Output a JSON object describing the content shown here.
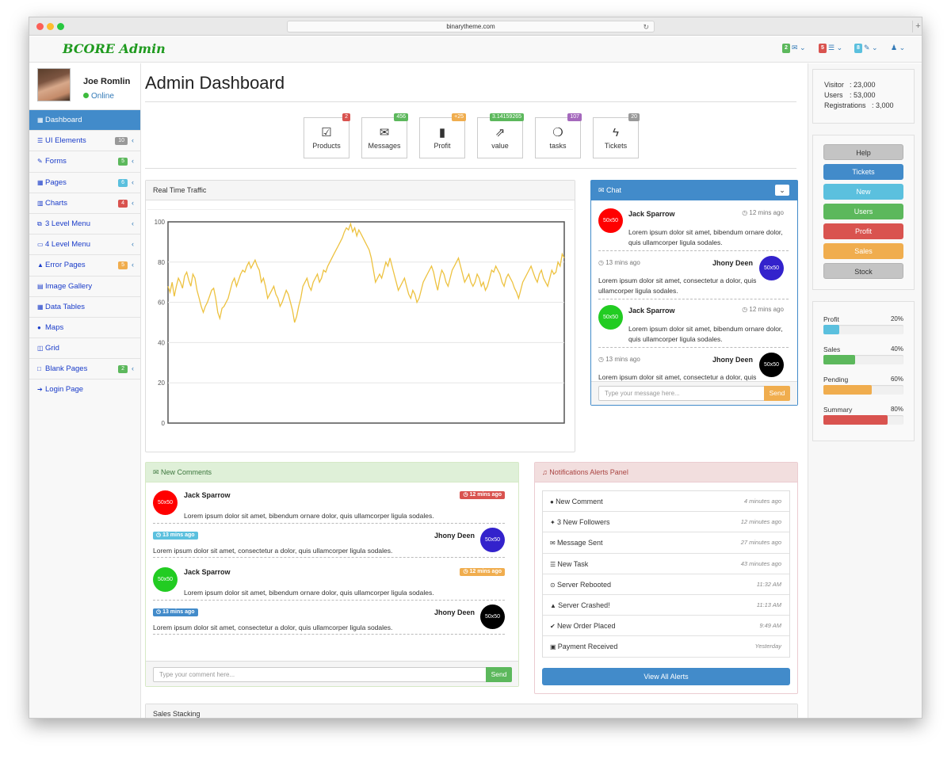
{
  "browser": {
    "url": "binarytheme.com"
  },
  "app": {
    "brand": "BCORE Admin"
  },
  "topnav": {
    "items": [
      {
        "badge": "2",
        "badge_color": "#5cb85c",
        "icon": "envelope-icon"
      },
      {
        "badge": "5",
        "badge_color": "#d9534f",
        "icon": "tasks-icon"
      },
      {
        "badge": "8",
        "badge_color": "#5bc0de",
        "icon": "comments-icon"
      },
      {
        "badge": "",
        "icon": "user-icon"
      }
    ]
  },
  "user": {
    "name": "Joe Romlin",
    "status": "Online"
  },
  "sidebar": {
    "items": [
      {
        "label": "Dashboard",
        "icon": "table-icon",
        "badge": "",
        "active": true
      },
      {
        "label": "UI Elements",
        "icon": "tasks-icon",
        "badge": "10",
        "badge_color": "#999999"
      },
      {
        "label": "Forms",
        "icon": "pencil-icon",
        "badge": "5",
        "badge_color": "#5cb85c"
      },
      {
        "label": "Pages",
        "icon": "table-icon",
        "badge": "6",
        "badge_color": "#5bc0de"
      },
      {
        "label": "Charts",
        "icon": "bar-chart-icon",
        "badge": "4",
        "badge_color": "#d9534f"
      },
      {
        "label": "3 Level Menu",
        "icon": "sitemap-icon",
        "badge": ""
      },
      {
        "label": "4 Level Menu",
        "icon": "folder-icon",
        "badge": ""
      },
      {
        "label": "Error Pages",
        "icon": "warning-icon",
        "badge": "5",
        "badge_color": "#f0ad4e"
      },
      {
        "label": "Image Gallery",
        "icon": "film-icon",
        "badge": ""
      },
      {
        "label": "Data Tables",
        "icon": "table-icon",
        "badge": ""
      },
      {
        "label": "Maps",
        "icon": "map-marker-icon",
        "badge": ""
      },
      {
        "label": "Grid",
        "icon": "columns-icon",
        "badge": ""
      },
      {
        "label": "Blank Pages",
        "icon": "square-icon",
        "badge": "2",
        "badge_color": "#5cb85c"
      },
      {
        "label": "Login Page",
        "icon": "sign-in-icon",
        "badge": ""
      }
    ]
  },
  "page": {
    "title": "Admin Dashboard"
  },
  "stats": [
    {
      "label": "Products",
      "badge": "2",
      "badge_color": "#d9534f",
      "icon": "check-square-icon"
    },
    {
      "label": "Messages",
      "badge": "456",
      "badge_color": "#5cb85c",
      "icon": "envelope-icon"
    },
    {
      "label": "Profit",
      "badge": "+25",
      "badge_color": "#f0ad4e",
      "icon": "signal-icon"
    },
    {
      "label": "value",
      "badge": "3.14159265",
      "badge_color": "#5cb85c",
      "icon": "external-link-icon"
    },
    {
      "label": "tasks",
      "badge": "107",
      "badge_color": "#a569bd",
      "icon": "leaf-icon"
    },
    {
      "label": "Tickets",
      "badge": "20",
      "badge_color": "#999999",
      "icon": "bolt-icon"
    }
  ],
  "traffic": {
    "title": "Real Time Traffic"
  },
  "chart_data": {
    "type": "line",
    "title": "",
    "xlabel": "",
    "ylabel": "",
    "ylim": [
      0,
      100
    ],
    "yticks": [
      "0",
      "20",
      "40",
      "60",
      "80",
      "100"
    ],
    "color": "#edc240",
    "values": [
      68,
      65,
      70,
      63,
      68,
      72,
      70,
      67,
      73,
      75,
      71,
      68,
      74,
      72,
      66,
      62,
      58,
      55,
      58,
      60,
      63,
      66,
      67,
      62,
      55,
      52,
      57,
      58,
      60,
      62,
      66,
      70,
      72,
      68,
      71,
      74,
      76,
      75,
      78,
      80,
      77,
      79,
      81,
      78,
      76,
      70,
      72,
      68,
      62,
      64,
      66,
      68,
      64,
      62,
      58,
      60,
      63,
      66,
      64,
      60,
      56,
      50,
      53,
      58,
      62,
      68,
      70,
      72,
      68,
      66,
      70,
      72,
      74,
      70,
      72,
      76,
      75,
      78,
      80,
      82,
      84,
      86,
      88,
      90,
      92,
      95,
      97,
      96,
      99,
      95,
      97,
      93,
      96,
      94,
      92,
      90,
      88,
      86,
      82,
      76,
      70,
      72,
      74,
      72,
      76,
      80,
      78,
      82,
      78,
      74,
      70,
      66,
      68,
      70,
      72,
      68,
      64,
      62,
      66,
      64,
      60,
      62,
      66,
      70,
      72,
      74,
      76,
      78,
      75,
      70,
      66,
      72,
      76,
      74,
      70,
      68,
      72,
      76,
      78,
      80,
      82,
      78,
      74,
      70,
      72,
      74,
      70,
      68,
      70,
      74,
      72,
      68,
      70,
      66,
      68,
      72,
      76,
      75,
      78,
      76,
      74,
      70,
      68,
      72,
      74,
      72,
      70,
      67,
      65,
      62,
      66,
      70,
      72,
      74,
      76,
      78,
      75,
      72,
      70,
      74,
      76,
      72,
      70,
      68,
      72,
      76,
      74,
      75,
      80,
      78,
      84,
      82
    ]
  },
  "chat": {
    "title": "Chat",
    "messages": [
      {
        "name": "Jack Sparrow",
        "time": "12 mins ago",
        "text": "Lorem ipsum dolor sit amet, bibendum ornare dolor, quis ullamcorper ligula sodales.",
        "avatar": "50x50",
        "avatar_color": "#ff0000",
        "side": "left"
      },
      {
        "name": "Jhony Deen",
        "time": "13 mins ago",
        "text": "Lorem ipsum dolor sit amet, consectetur a dolor, quis ullamcorper ligula sodales.",
        "avatar": "50x50",
        "avatar_color": "#3322cc",
        "side": "right"
      },
      {
        "name": "Jack Sparrow",
        "time": "12 mins ago",
        "text": "Lorem ipsum dolor sit amet, bibendum ornare dolor, quis ullamcorper ligula sodales.",
        "avatar": "50x50",
        "avatar_color": "#22cc22",
        "side": "left"
      },
      {
        "name": "Jhony Deen",
        "time": "13 mins ago",
        "text": "Lorem ipsum dolor sit amet, consectetur a dolor, quis ullamcorper ligula sodales.",
        "avatar": "50x50",
        "avatar_color": "#000000",
        "side": "right"
      }
    ],
    "input_placeholder": "Type your message here...",
    "send": "Send"
  },
  "comments": {
    "title": "New Comments",
    "items": [
      {
        "name": "Jack Sparrow",
        "time": "12 mins ago",
        "time_color": "#d9534f",
        "text": "Lorem ipsum dolor sit amet, bibendum ornare dolor, quis ullamcorper ligula sodales.",
        "avatar": "50x50",
        "avatar_color": "#ff0000",
        "side": "left"
      },
      {
        "name": "Jhony Deen",
        "time": "13 mins ago",
        "time_color": "#5bc0de",
        "text": "Lorem ipsum dolor sit amet, consectetur a dolor, quis ullamcorper ligula sodales.",
        "avatar": "50x50",
        "avatar_color": "#3322cc",
        "side": "right"
      },
      {
        "name": "Jack Sparrow",
        "time": "12 mins ago",
        "time_color": "#f0ad4e",
        "text": "Lorem ipsum dolor sit amet, bibendum ornare dolor, quis ullamcorper ligula sodales.",
        "avatar": "50x50",
        "avatar_color": "#22cc22",
        "side": "left"
      },
      {
        "name": "Jhony Deen",
        "time": "13 mins ago",
        "time_color": "#428bca",
        "text": "Lorem ipsum dolor sit amet, consectetur a dolor, quis ullamcorper ligula sodales.",
        "avatar": "50x50",
        "avatar_color": "#000000",
        "side": "right"
      }
    ],
    "input_placeholder": "Type your comment here...",
    "send": "Send"
  },
  "alerts": {
    "title": "Notifications Alerts Panel",
    "items": [
      {
        "label": "New Comment",
        "time": "4 minutes ago",
        "icon": "comment-icon"
      },
      {
        "label": "3 New Followers",
        "time": "12 minutes ago",
        "icon": "twitter-icon"
      },
      {
        "label": "Message Sent",
        "time": "27 minutes ago",
        "icon": "envelope-icon"
      },
      {
        "label": "New Task",
        "time": "43 minutes ago",
        "icon": "tasks-icon"
      },
      {
        "label": "Server Rebooted",
        "time": "11:32 AM",
        "icon": "upload-icon"
      },
      {
        "label": "Server Crashed!",
        "time": "11:13 AM",
        "icon": "warning-icon"
      },
      {
        "label": "New Order Placed",
        "time": "9:49 AM",
        "icon": "check-icon"
      },
      {
        "label": "Payment Received",
        "time": "Yesterday",
        "icon": "money-icon"
      }
    ],
    "view_all": "View All Alerts"
  },
  "sales": {
    "title": "Sales Stacking"
  },
  "stats_box": {
    "rows": [
      {
        "label": "Visitor",
        "value": ": 23,000"
      },
      {
        "label": "Users",
        "value": ": 53,000"
      },
      {
        "label": "Registrations",
        "value": ": 3,000"
      }
    ]
  },
  "quick_buttons": [
    {
      "label": "Help",
      "color": "#c4c4c4",
      "text_color": "#333333"
    },
    {
      "label": "Tickets",
      "color": "#428bca",
      "text_color": "#ffffff"
    },
    {
      "label": "New",
      "color": "#5bc0de",
      "text_color": "#ffffff"
    },
    {
      "label": "Users",
      "color": "#5cb85c",
      "text_color": "#ffffff"
    },
    {
      "label": "Profit",
      "color": "#d9534f",
      "text_color": "#ffffff"
    },
    {
      "label": "Sales",
      "color": "#f0ad4e",
      "text_color": "#ffffff"
    },
    {
      "label": "Stock",
      "color": "#c4c4c4",
      "text_color": "#333333"
    }
  ],
  "progress": [
    {
      "label": "Profit",
      "value": "20%",
      "fraction": 0.2,
      "color": "#5bc0de"
    },
    {
      "label": "Sales",
      "value": "40%",
      "fraction": 0.4,
      "color": "#5cb85c"
    },
    {
      "label": "Pending",
      "value": "60%",
      "fraction": 0.6,
      "color": "#f0ad4e"
    },
    {
      "label": "Summary",
      "value": "80%",
      "fraction": 0.8,
      "color": "#d9534f"
    }
  ]
}
